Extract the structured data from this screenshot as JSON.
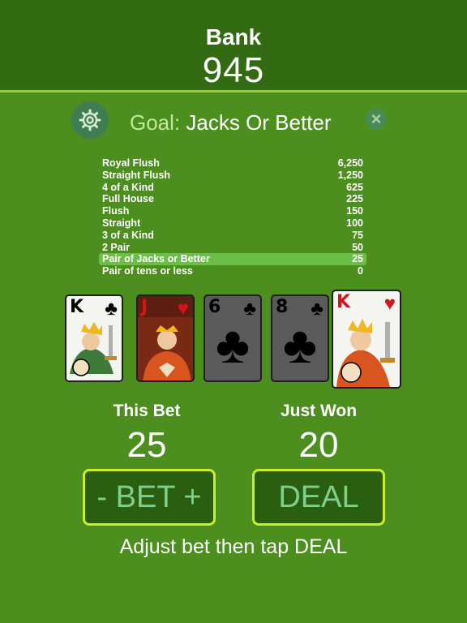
{
  "header": {
    "bank_label": "Bank",
    "bank_value": "945"
  },
  "goal": {
    "prefix": "Goal:",
    "name": "Jacks Or Better",
    "settings_icon": "gear-icon",
    "close_icon": "close-icon"
  },
  "paytable": [
    {
      "hand": "Royal Flush",
      "payout": "6,250"
    },
    {
      "hand": "Straight Flush",
      "payout": "1,250"
    },
    {
      "hand": "4 of a Kind",
      "payout": "625"
    },
    {
      "hand": "Full House",
      "payout": "225"
    },
    {
      "hand": "Flush",
      "payout": "150"
    },
    {
      "hand": "Straight",
      "payout": "100"
    },
    {
      "hand": "3 of a Kind",
      "payout": "75"
    },
    {
      "hand": "2 Pair",
      "payout": "50"
    },
    {
      "hand": "Pair of Jacks or Better",
      "payout": "25",
      "highlighted": true
    },
    {
      "hand": "Pair of tens or less",
      "payout": "0"
    }
  ],
  "cards": [
    {
      "rank": "K",
      "suit": "♣",
      "color": "black",
      "held": false
    },
    {
      "rank": "J",
      "suit": "♥",
      "color": "red",
      "held": false
    },
    {
      "rank": "6",
      "suit": "♣",
      "color": "black",
      "held": false
    },
    {
      "rank": "8",
      "suit": "♣",
      "color": "black",
      "held": false
    },
    {
      "rank": "K",
      "suit": "♥",
      "color": "red",
      "held": true
    }
  ],
  "stats": {
    "bet_label": "This Bet",
    "bet_value": "25",
    "won_label": "Just Won",
    "won_value": "20"
  },
  "buttons": {
    "bet": "- BET +",
    "deal": "DEAL"
  },
  "hint": "Adjust bet then tap DEAL",
  "colors": {
    "felt": "#4c8f1f",
    "header": "#336b12",
    "button_border": "#c8ee2e",
    "highlight": "#6bbf46"
  }
}
